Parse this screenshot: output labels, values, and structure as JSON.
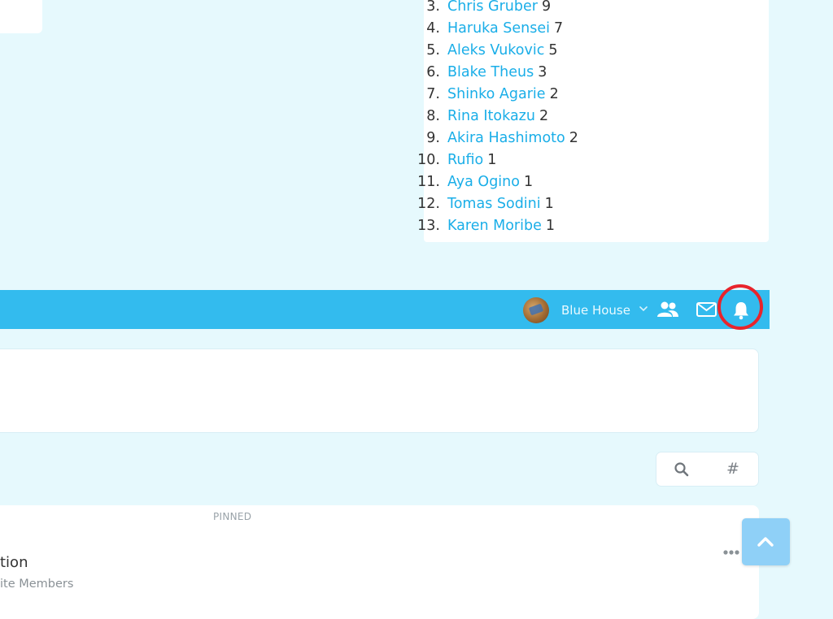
{
  "leaderboard": {
    "entries": [
      {
        "rank": "3.",
        "name": "Chris Gruber",
        "score": "9"
      },
      {
        "rank": "4.",
        "name": "Haruka Sensei",
        "score": "7"
      },
      {
        "rank": "5.",
        "name": "Aleks Vukovic",
        "score": "5"
      },
      {
        "rank": "6.",
        "name": "Blake Theus",
        "score": "3"
      },
      {
        "rank": "7.",
        "name": "Shinko Agarie",
        "score": "2"
      },
      {
        "rank": "8.",
        "name": "Rina Itokazu",
        "score": "2"
      },
      {
        "rank": "9.",
        "name": "Akira Hashimoto",
        "score": "2"
      },
      {
        "rank": "10.",
        "name": "Rufio",
        "score": "1"
      },
      {
        "rank": "11.",
        "name": "Aya Ogino",
        "score": "1"
      },
      {
        "rank": "12.",
        "name": "Tomas Sodini",
        "score": "1"
      },
      {
        "rank": "13.",
        "name": "Karen Moribe",
        "score": "1"
      }
    ]
  },
  "navbar": {
    "house_name": "Blue House",
    "icons": [
      "house-avatar",
      "chevron-down-icon",
      "members-icon",
      "mail-icon",
      "bell-icon"
    ],
    "highlight_color": "#e8242b",
    "bar_color": "#33bbee"
  },
  "toolbar": {
    "search_icon": "search-icon",
    "hashtag_label": "#"
  },
  "feed": {
    "pinned_label": "PINNED",
    "post_title_fragment": "tion",
    "post_subtitle_fragment": "ite Members",
    "more_icon": "more-dots-icon"
  },
  "back_to_top_icon": "chevron-up-icon",
  "colors": {
    "background": "#e6f9fd",
    "link": "#1aaee8"
  }
}
